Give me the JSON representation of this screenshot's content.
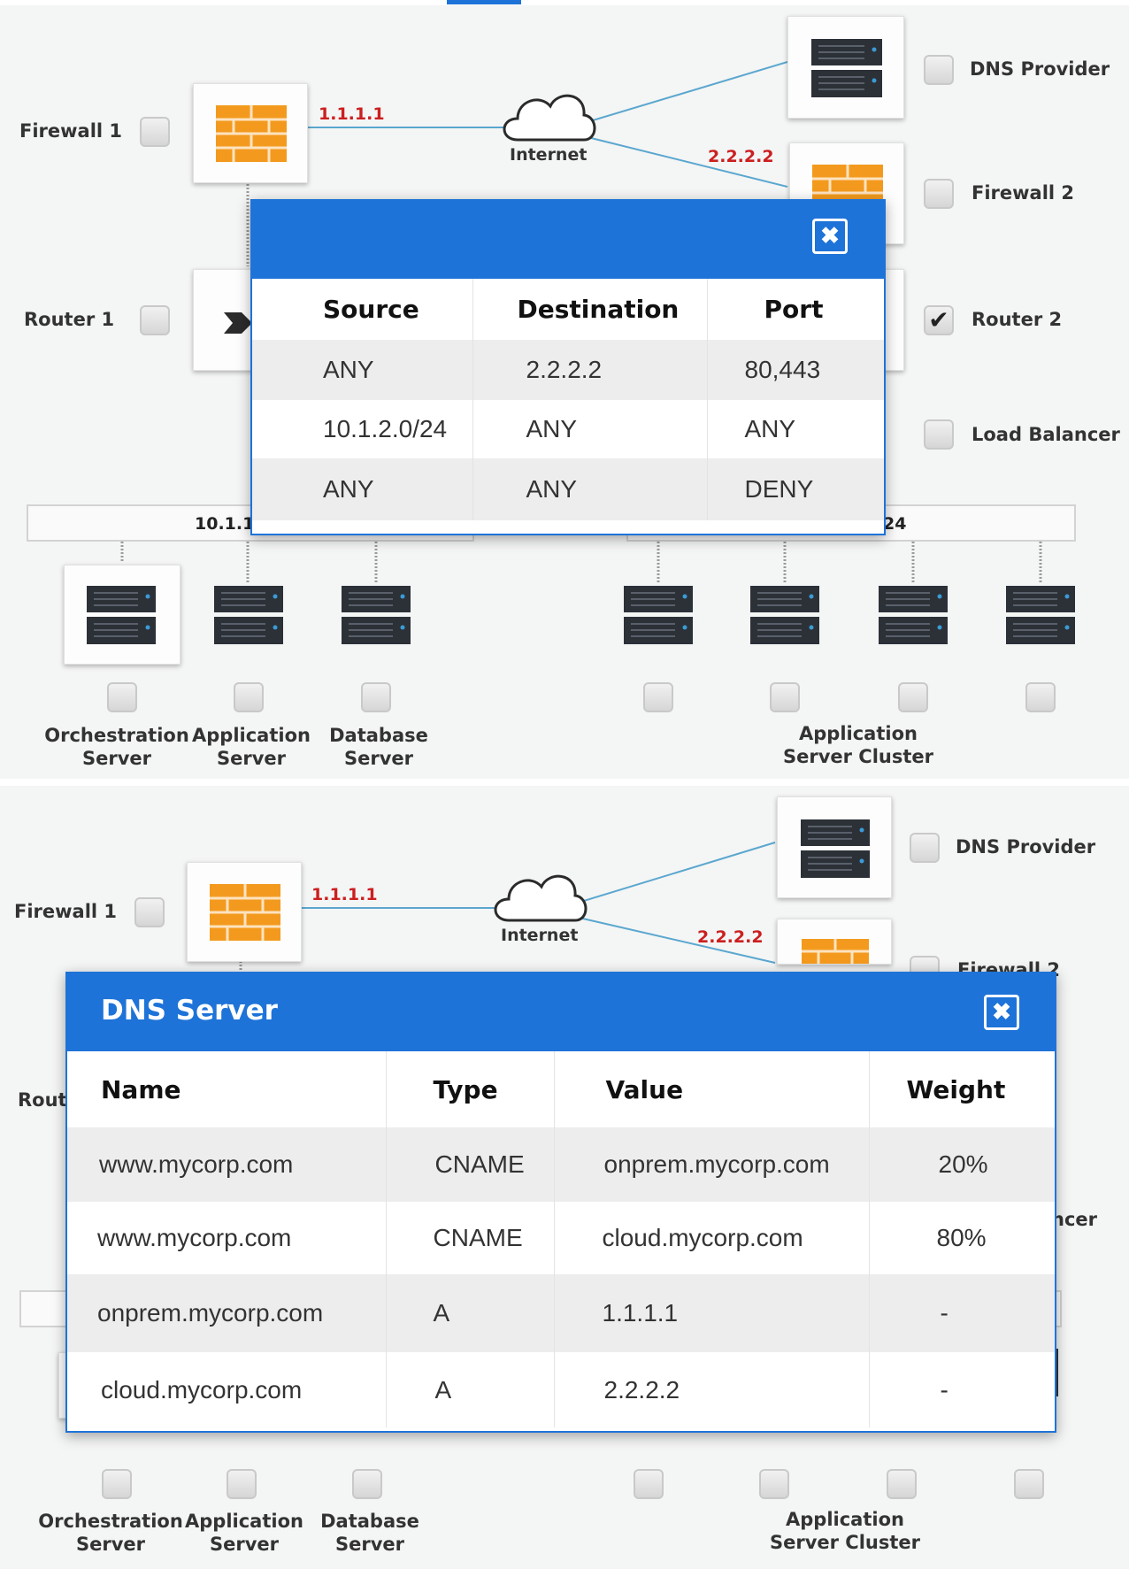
{
  "topology": {
    "internet_label": "Internet",
    "ip_firewall1": "1.1.1.1",
    "ip_firewall2": "2.2.2.2",
    "labels": {
      "firewall1": "Firewall 1",
      "router1": "Router 1",
      "dns_provider": "DNS Provider",
      "firewall2": "Firewall 2",
      "router2": "Router 2",
      "load_balancer": "Load Balancer"
    },
    "subnet_left": "10.1.1",
    "subnet_right": "24",
    "servers": {
      "orchestration": [
        "Orchestration",
        "Server"
      ],
      "application": [
        "Application",
        "Server"
      ],
      "database": [
        "Database",
        "Server"
      ],
      "cluster": [
        "Application",
        "Server Cluster"
      ]
    },
    "bottom_partial": {
      "router1": "Rout",
      "firewall2": "Firewall 2",
      "load_balancer": "ncer"
    },
    "checked": {
      "router2": true
    }
  },
  "firewall_rules_dialog": {
    "title": "",
    "columns": [
      "Source",
      "Destination",
      "Port"
    ],
    "rows": [
      [
        "ANY",
        "2.2.2.2",
        "80,443"
      ],
      [
        "10.1.2.0/24",
        "ANY",
        "ANY"
      ],
      [
        "ANY",
        "ANY",
        "DENY"
      ]
    ]
  },
  "dns_dialog": {
    "title": "DNS Server",
    "columns": [
      "Name",
      "Type",
      "Value",
      "Weight"
    ],
    "rows": [
      [
        "www.mycorp.com",
        "CNAME",
        "onprem.mycorp.com",
        "20%"
      ],
      [
        "www.mycorp.com",
        "CNAME",
        "cloud.mycorp.com",
        "80%"
      ],
      [
        "onprem.mycorp.com",
        "A",
        "1.1.1.1",
        "-"
      ],
      [
        "cloud.mycorp.com",
        "A",
        "2.2.2.2",
        "-"
      ]
    ]
  },
  "icons": {
    "close": "✖",
    "check": "✔"
  },
  "colors": {
    "accent": "#1e73d8",
    "ip_label": "#cc1f1f",
    "firewall": "#f39a1e",
    "link": "#5aa7cf"
  }
}
